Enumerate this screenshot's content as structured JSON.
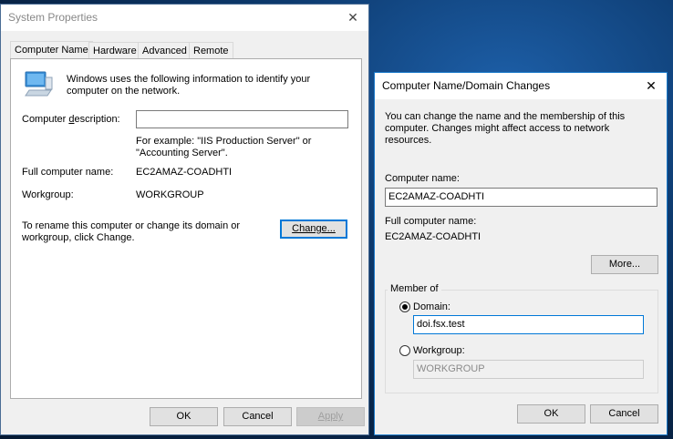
{
  "system_properties": {
    "title": "System Properties",
    "close_glyph": "✕",
    "tabs": [
      {
        "label": "Computer Name"
      },
      {
        "label": "Hardware"
      },
      {
        "label": "Advanced"
      },
      {
        "label": "Remote"
      }
    ],
    "intro": "Windows uses the following information to identify your computer on the network.",
    "description_label": "Computer description:",
    "description_value": "",
    "example_text": "For example: \"IIS Production Server\" or \"Accounting Server\".",
    "full_name_label": "Full computer name:",
    "full_name_value": "EC2AMAZ-COADHTI",
    "workgroup_label": "Workgroup:",
    "workgroup_value": "WORKGROUP",
    "rename_text": "To rename this computer or change its domain or workgroup, click Change.",
    "change_button": "Change...",
    "ok_button": "OK",
    "cancel_button": "Cancel",
    "apply_button": "Apply",
    "computer_icon": "computer-icon"
  },
  "domain_changes": {
    "title": "Computer Name/Domain Changes",
    "close_glyph": "✕",
    "intro": "You can change the name and the membership of this computer. Changes might affect access to network resources.",
    "computer_name_label": "Computer name:",
    "computer_name_value": "EC2AMAZ-COADHTI",
    "full_name_label": "Full computer name:",
    "full_name_value": "EC2AMAZ-COADHTI",
    "more_button": "More...",
    "member_of_label": "Member of",
    "domain_label": "Domain:",
    "domain_value": "doi.fsx.test",
    "domain_selected": true,
    "workgroup_label": "Workgroup:",
    "workgroup_value": "WORKGROUP",
    "ok_button": "OK",
    "cancel_button": "Cancel"
  }
}
